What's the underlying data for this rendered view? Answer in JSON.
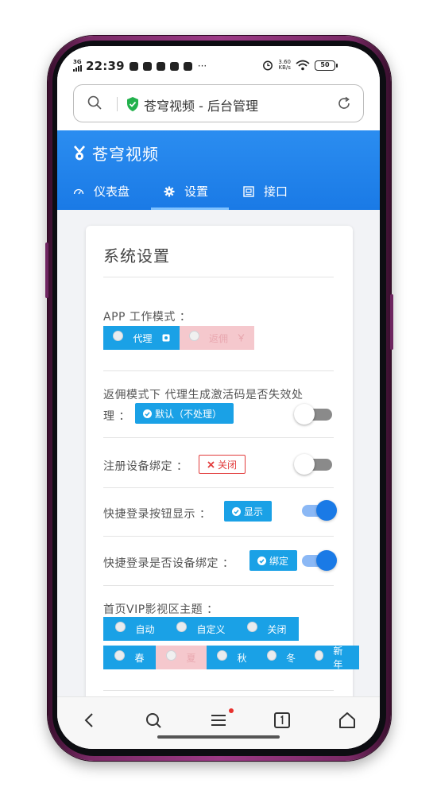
{
  "status_bar": {
    "network": "3G",
    "time": "22:39",
    "more": "···",
    "speed_value": "3.60",
    "speed_unit": "KB/s",
    "battery": "50"
  },
  "address_bar": {
    "title": "苍穹视频 - 后台管理"
  },
  "header": {
    "brand": "苍穹视频",
    "nav": [
      {
        "label": "仪表盘",
        "icon": "dashboard-icon"
      },
      {
        "label": "设置",
        "icon": "gear-icon"
      },
      {
        "label": "接口",
        "icon": "api-icon"
      }
    ],
    "active_index": 1
  },
  "settings": {
    "title": "系统设置",
    "app_mode": {
      "label": "APP 工作模式 ：",
      "options": [
        "代理",
        "返佣"
      ],
      "selected": "代理"
    },
    "rebate_code": {
      "label_line1": "返佣模式下 代理生成激活码是否失效处",
      "label_line2": "理 ：",
      "badge": "默认（不处理）",
      "toggle_on": false
    },
    "device_bind": {
      "label": "注册设备绑定 ：",
      "badge": "关闭",
      "toggle_on": false
    },
    "quick_login_show": {
      "label": "快捷登录按钮显示 ：",
      "badge": "显示",
      "toggle_on": true
    },
    "quick_login_bind": {
      "label": "快捷登录是否设备绑定 ：",
      "badge": "绑定",
      "toggle_on": true
    },
    "vip_theme": {
      "label": "首页VIP影视区主题 ：",
      "row1": [
        "自动",
        "自定义",
        "关闭"
      ],
      "row2": [
        "春",
        "夏",
        "秋",
        "冬",
        "新年"
      ],
      "selected_off": "夏"
    }
  },
  "colors": {
    "accent": "#1a7ae6",
    "segment_blue": "#1aa1e6",
    "segment_pink": "#f5c8cd",
    "danger": "#e23c3c"
  }
}
